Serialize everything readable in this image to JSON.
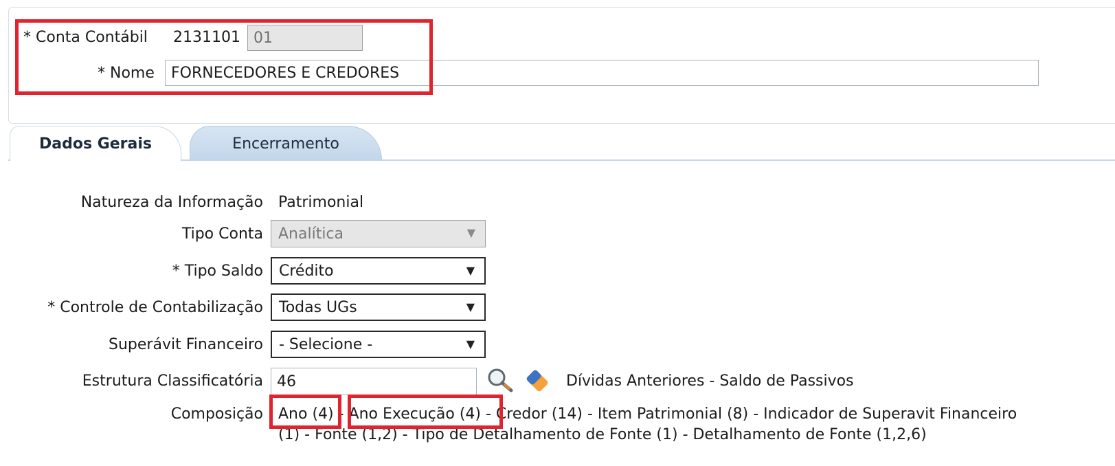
{
  "header": {
    "conta_label": "* Conta Contábil",
    "conta_value": "2131101",
    "conta_suffix": "01",
    "nome_label": "* Nome",
    "nome_value": "FORNECEDORES E CREDORES"
  },
  "tabs": [
    {
      "label": "Dados Gerais",
      "active": true
    },
    {
      "label": "Encerramento",
      "active": false
    }
  ],
  "form": {
    "natureza_label": "Natureza da Informação",
    "natureza_value": "Patrimonial",
    "tipo_conta_label": "Tipo Conta",
    "tipo_conta_value": "Analítica",
    "tipo_saldo_label": "* Tipo Saldo",
    "tipo_saldo_value": "Crédito",
    "controle_label": "* Controle de Contabilização",
    "controle_value": "Todas UGs",
    "superavit_label": "Superávit Financeiro",
    "superavit_value": "- Selecione -",
    "estrutura_label": "Estrutura Classificatória",
    "estrutura_value": "46",
    "estrutura_desc": "Dívidas Anteriores - Saldo de Passivos",
    "composicao_label": "Composição",
    "composicao_line1": "Ano (4) - Ano Execução (4) - Credor (14) - Item Patrimonial (8) - Indicador de Superavit Financeiro",
    "composicao_line2": "(1) - Fonte (1,2) - Tipo de Detalhamento de Fonte (1) - Detalhamento de Fonte (1,2,6)"
  },
  "icons": {
    "search": "magnifier-icon",
    "clear": "eraser-icon",
    "dropdown": "triangle-down-icon"
  },
  "colors": {
    "highlight": "#e0242f",
    "tab_inactive": "#c8dbee",
    "panel_border": "#d9dde2"
  }
}
